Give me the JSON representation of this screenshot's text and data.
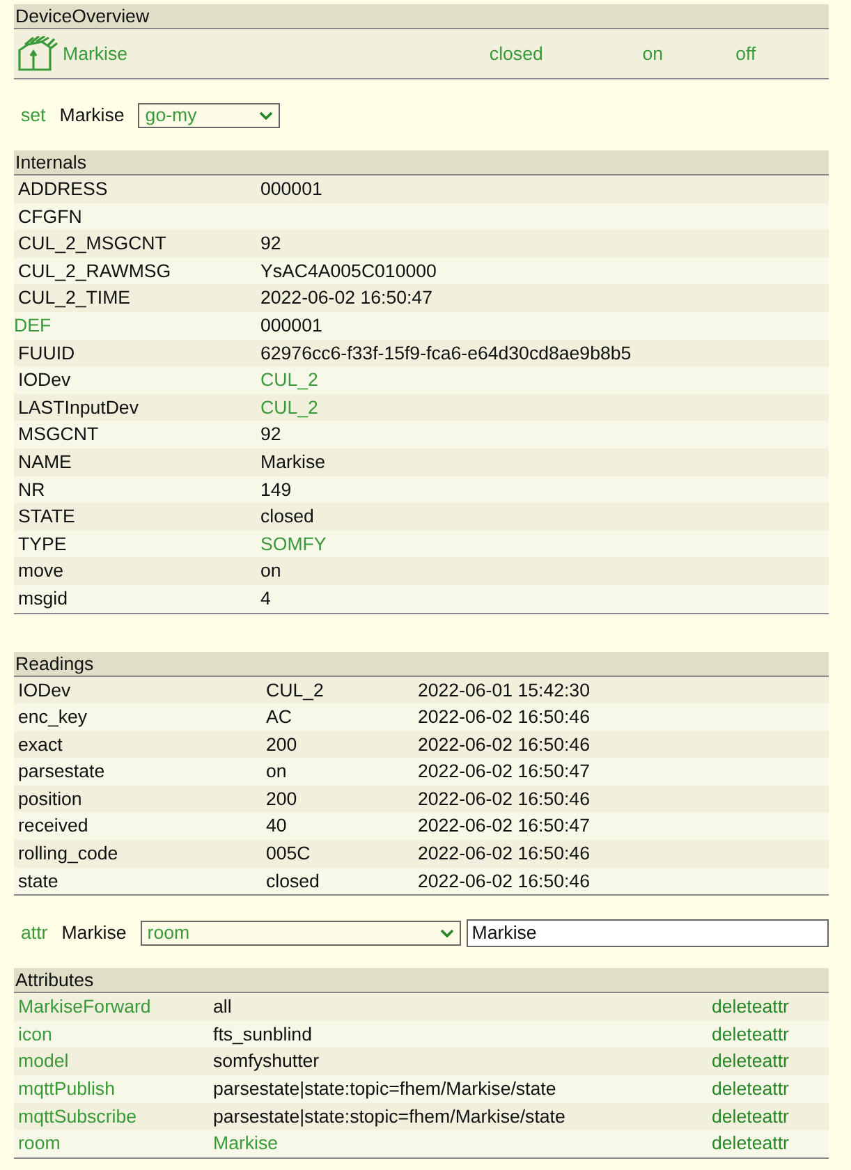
{
  "device_overview": {
    "title": "DeviceOverview",
    "device": {
      "name": "Markise",
      "state": "closed",
      "commands": [
        "on",
        "off"
      ]
    }
  },
  "set_command": {
    "label": "set",
    "device": "Markise",
    "value": "go-my"
  },
  "internals": {
    "title": "Internals",
    "rows": [
      {
        "key": "ADDRESS",
        "value": "000001",
        "key_link": false,
        "value_link": false
      },
      {
        "key": "CFGFN",
        "key_link": false
      },
      {
        "key": "CUL_2_MSGCNT",
        "value": "92",
        "key_link": false,
        "value_link": false
      },
      {
        "key": "CUL_2_RAWMSG",
        "value": "YsAC4A005C010000",
        "key_link": false,
        "value_link": false
      },
      {
        "key": "CUL_2_TIME",
        "value": "2022-06-02 16:50:47",
        "key_link": false,
        "value_link": false
      },
      {
        "key": "DEF",
        "value": "000001",
        "key_link": true,
        "value_link": false
      },
      {
        "key": "FUUID",
        "value": "62976cc6-f33f-15f9-fca6-e64d30cd8ae9b8b5",
        "key_link": false,
        "value_link": false
      },
      {
        "key": "IODev",
        "value": "CUL_2",
        "key_link": false,
        "value_link": true
      },
      {
        "key": "LASTInputDev",
        "value": "CUL_2",
        "key_link": false,
        "value_link": true
      },
      {
        "key": "MSGCNT",
        "value": "92",
        "key_link": false,
        "value_link": false
      },
      {
        "key": "NAME",
        "value": "Markise",
        "key_link": false,
        "value_link": false
      },
      {
        "key": "NR",
        "value": "149",
        "key_link": false,
        "value_link": false
      },
      {
        "key": "STATE",
        "value": "closed",
        "key_link": false,
        "value_link": false
      },
      {
        "key": "TYPE",
        "value": "SOMFY",
        "key_link": false,
        "value_link": true
      },
      {
        "key": "move",
        "value": "on",
        "key_link": false,
        "value_link": false
      },
      {
        "key": "msgid",
        "value": "4",
        "key_link": false,
        "value_link": false
      }
    ]
  },
  "readings": {
    "title": "Readings",
    "rows": [
      {
        "key": "IODev",
        "value": "CUL_2",
        "time": "2022-06-01 15:42:30"
      },
      {
        "key": "enc_key",
        "value": "AC",
        "time": "2022-06-02 16:50:46"
      },
      {
        "key": "exact",
        "value": "200",
        "time": "2022-06-02 16:50:46"
      },
      {
        "key": "parsestate",
        "value": "on",
        "time": "2022-06-02 16:50:47"
      },
      {
        "key": "position",
        "value": "200",
        "time": "2022-06-02 16:50:46"
      },
      {
        "key": "received",
        "value": "40",
        "time": "2022-06-02 16:50:47"
      },
      {
        "key": "rolling_code",
        "value": "005C",
        "time": "2022-06-02 16:50:46"
      },
      {
        "key": "state",
        "value": "closed",
        "time": "2022-06-02 16:50:46"
      }
    ]
  },
  "attr_command": {
    "label": "attr",
    "device": "Markise",
    "attribute": "room",
    "value": "Markise"
  },
  "attributes": {
    "title": "Attributes",
    "rows": [
      {
        "key": "MarkiseForward",
        "value": "all",
        "value_link": false,
        "action": "deleteattr"
      },
      {
        "key": "icon",
        "value": "fts_sunblind",
        "value_link": false,
        "action": "deleteattr"
      },
      {
        "key": "model",
        "value": "somfyshutter",
        "value_link": false,
        "action": "deleteattr"
      },
      {
        "key": "mqttPublish",
        "value": "parsestate|state:topic=fhem/Markise/state",
        "value_link": false,
        "action": "deleteattr"
      },
      {
        "key": "mqttSubscribe",
        "value": "parsestate|state:stopic=fhem/Markise/state",
        "value_link": false,
        "action": "deleteattr"
      },
      {
        "key": "room",
        "value": "Markise",
        "value_link": true,
        "action": "deleteattr"
      }
    ]
  }
}
